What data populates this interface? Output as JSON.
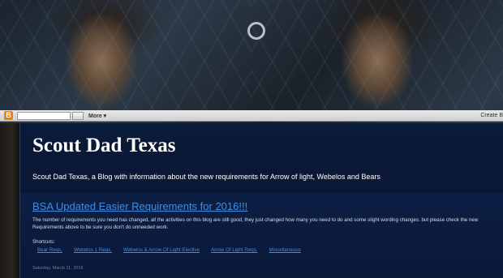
{
  "navbar": {
    "logo_letter": "B",
    "more_label": "More ▾",
    "create_label": "Create B"
  },
  "blog": {
    "title": "Scout Dad Texas",
    "description": "Scout Dad Texas, a Blog with information about the new requirements for Arrow of light, Webelos and Bears"
  },
  "post": {
    "title": "BSA Updated Easier Requirements for 2016!!!",
    "body": "The number of requirements you need has changed, all the activities on this blog are still good, they just changed how many you need to do and some slight wording changes. but please check the new Requirements above to be sure you don't do unneeded work.",
    "shortcuts_label": "Shortcuts:",
    "shortcuts": [
      "Bear Reqs.",
      "Webelos 1 Reqs.",
      "Webelos & Arrow Of Light Elective",
      "Arrow Of Light Reqs.",
      "Miscellaneous"
    ],
    "date": "Saturday, March 11, 2016"
  },
  "colors": {
    "link": "#3d8fe8",
    "panel": "#0a1a3a",
    "blogger_orange": "#f57d00"
  }
}
